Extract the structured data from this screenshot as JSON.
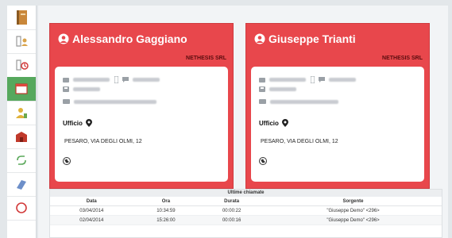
{
  "sidebar": {
    "items": [
      {
        "icon": "phonebook-icon"
      },
      {
        "icon": "contact-card-icon"
      },
      {
        "icon": "missed-call-icon"
      },
      {
        "icon": "calendar-icon",
        "active": true
      },
      {
        "icon": "user-status-icon"
      },
      {
        "icon": "building-icon"
      },
      {
        "icon": "call-transfer-icon"
      },
      {
        "icon": "queue-icon"
      },
      {
        "icon": "help-icon"
      }
    ]
  },
  "cards": [
    {
      "name": "Alessandro Gaggiano",
      "company": "NETHESIS SRL",
      "office_label": "Ufficio",
      "address": "PESARO, VIA DEGLI OLMI, 12"
    },
    {
      "name": "Giuseppe Trianti",
      "company": "NETHESIS SRL",
      "office_label": "Ufficio",
      "address": "PESARO, VIA DEGLI OLMI, 12"
    }
  ],
  "calls": {
    "title": "Ultime chiamate",
    "columns": [
      "Data",
      "Ora",
      "Durata",
      "Sorgente"
    ],
    "rows": [
      {
        "data": "03/04/2014",
        "ora": "10:34:59",
        "durata": "00:00:22",
        "sorgente": "\"Giuseppe Demo\" <296>"
      },
      {
        "data": "02/04/2014",
        "ora": "15:26:00",
        "durata": "00:00:16",
        "sorgente": "\"Giuseppe Demo\" <296>"
      }
    ]
  },
  "colors": {
    "card_bg": "#e8474c",
    "company_text": "#5a0c0e",
    "active_sidebar": "#56a85d"
  }
}
